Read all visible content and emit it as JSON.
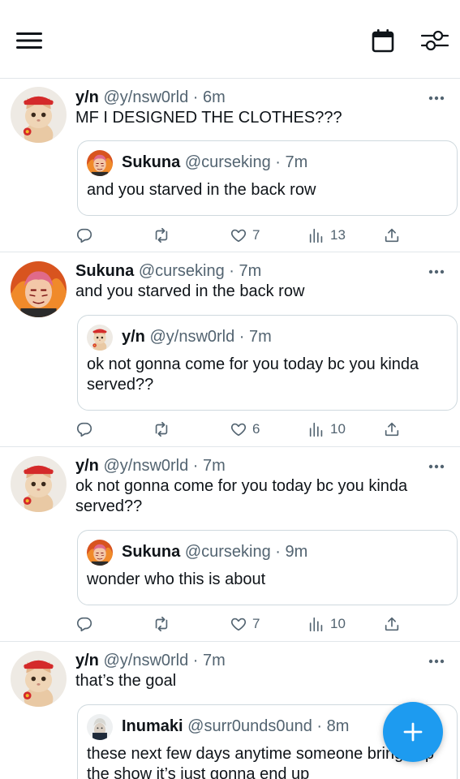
{
  "colors": {
    "accent": "#1d9bf0",
    "text": "#0f1419",
    "muted": "#536471",
    "border": "#e1e6ea"
  },
  "topbar": {
    "menu_icon": "menu-icon",
    "calendar_icon": "calendar-icon",
    "filter_icon": "filter-icon"
  },
  "tweets": [
    {
      "name": "y/n",
      "handle": "@y/nsw0rld · 6m",
      "text": "MF I DESIGNED THE CLOTHES???",
      "quote": {
        "name": "Sukuna",
        "handle": "@curseking · 7m",
        "text": "and you starved in the back row"
      },
      "likes": "7",
      "views": "13"
    },
    {
      "name": "Sukuna",
      "handle": "@curseking · 7m",
      "text": "and you starved in the back row",
      "quote": {
        "name": "y/n",
        "handle": "@y/nsw0rld · 7m",
        "text": "ok not gonna come for you today bc you kinda served??"
      },
      "likes": "6",
      "views": "10"
    },
    {
      "name": "y/n",
      "handle": "@y/nsw0rld · 7m",
      "text": "ok not gonna come for you today bc you kinda served??",
      "quote": {
        "name": "Sukuna",
        "handle": "@curseking · 9m",
        "text": "wonder who this is about"
      },
      "likes": "7",
      "views": "10"
    },
    {
      "name": "y/n",
      "handle": "@y/nsw0rld · 7m",
      "text": "that’s the goal",
      "quote": {
        "name": "Inumaki",
        "handle": "@surr0unds0und · 8m",
        "text": "these next few days anytime someone brings up the show it’s just gonna end up"
      }
    }
  ],
  "fab": {
    "icon": "plus-icon"
  }
}
